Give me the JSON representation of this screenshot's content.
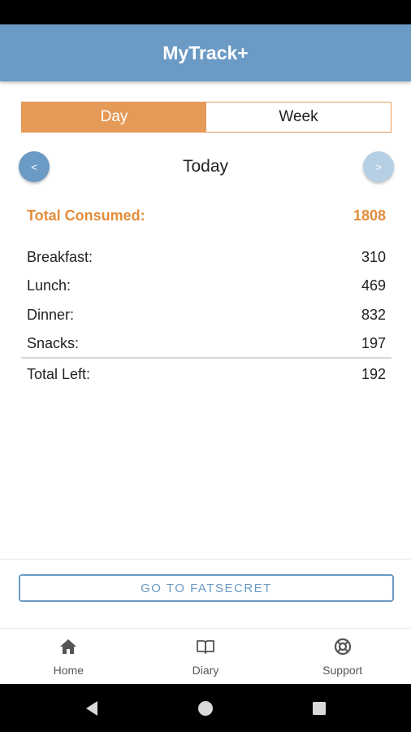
{
  "app": {
    "title": "MyTrack+"
  },
  "segment": {
    "day_label": "Day",
    "week_label": "Week",
    "selected": "Day"
  },
  "date_nav": {
    "prev_label": "<",
    "next_label": ">",
    "current": "Today"
  },
  "summary": {
    "total_consumed": {
      "label": "Total Consumed:",
      "value": "1808"
    },
    "meals": [
      {
        "label": "Breakfast:",
        "value": "310"
      },
      {
        "label": "Lunch:",
        "value": "469"
      },
      {
        "label": "Dinner:",
        "value": "832"
      },
      {
        "label": "Snacks:",
        "value": "197"
      }
    ],
    "total_left": {
      "label": "Total Left:",
      "value": "192"
    }
  },
  "fatsecret_button": {
    "label": "GO TO FATSECRET"
  },
  "bottom_nav": [
    {
      "label": "Home",
      "icon": "home-icon"
    },
    {
      "label": "Diary",
      "icon": "book-icon"
    },
    {
      "label": "Support",
      "icon": "lifebuoy-icon"
    }
  ],
  "colors": {
    "primary": "#6b9ac4",
    "accent": "#e59a58",
    "accent_text": "#e38d3c"
  }
}
